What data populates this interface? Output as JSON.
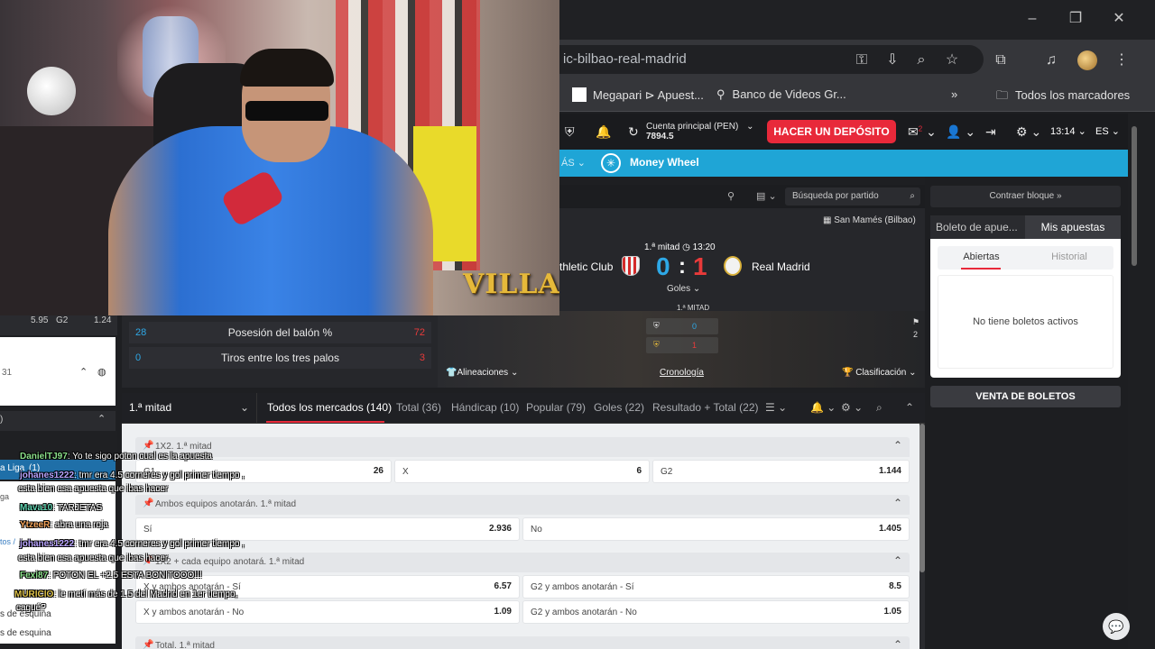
{
  "browser": {
    "url": "ic-bilbao-real-madrid",
    "window_controls": [
      "–",
      "❐",
      "✕"
    ],
    "bookmarks": [
      {
        "label": "Megapari ⊳ Apuest..."
      },
      {
        "label": "Banco de Videos Gr..."
      }
    ],
    "bookmarks_more": "»",
    "all_bookmarks": "Todos los marcadores"
  },
  "site": {
    "account_label": "Cuenta principal",
    "account_currency": "(PEN)",
    "account_balance": "7894.5",
    "deposit_button": "HACER UN DEPÓSITO",
    "messages_badge": "2",
    "time": "13:14",
    "language": "ES",
    "games_bar": {
      "more": "ÁS",
      "game": "Money Wheel"
    },
    "match_search_placeholder": "Búsqueda por partido"
  },
  "match": {
    "venue": "San Mamés (Bilbao)",
    "period": "1.ª mitad",
    "clock": "13:20",
    "home_team": "thletic Club",
    "away_team": "Real Madrid",
    "home_score": "0",
    "score_separator": ":",
    "away_score": "1",
    "goals_toggle": "Goles",
    "period_table_label": "1.ª MITAD",
    "period_home": "0",
    "period_away": "1",
    "side_number": "2",
    "links": {
      "lineups": "Alineaciones",
      "timeline": "Cronología",
      "standings": "Clasificación"
    }
  },
  "stats": [
    {
      "left": "28",
      "name": "Posesión del balón %",
      "right": "72"
    },
    {
      "left": "0",
      "name": "Tiros entre los tres palos",
      "right": "3"
    }
  ],
  "market_tabs": {
    "half": "1.ª mitad",
    "tabs": [
      "Todos los mercados (140)",
      "Total (36)",
      "Hándicap (10)",
      "Popular (79)",
      "Goles (22)",
      "Resultado + Total (22)"
    ]
  },
  "markets": [
    {
      "title": "1X2. 1.ª mitad",
      "odds": [
        {
          "name": "G1",
          "value": "26"
        },
        {
          "name": "X",
          "value": "6"
        },
        {
          "name": "G2",
          "value": "1.144"
        }
      ]
    },
    {
      "title": "Ambos equipos anotarán. 1.ª mitad",
      "odds": [
        {
          "name": "Sí",
          "value": "2.936"
        },
        {
          "name": "No",
          "value": "1.405"
        }
      ]
    },
    {
      "title": "1X2 + cada equipo anotará. 1.ª mitad",
      "odds": [
        {
          "name": "X y ambos anotarán - Sí",
          "value": "6.57"
        },
        {
          "name": "G2 y ambos anotarán - Sí",
          "value": "8.5"
        },
        {
          "name": "X y ambos anotarán - No",
          "value": "1.09"
        },
        {
          "name": "G2 y ambos anotarán - No",
          "value": "1.05"
        }
      ]
    },
    {
      "title": "Total. 1.ª mitad",
      "odds": []
    }
  ],
  "bet_slip": {
    "collapse": "Contraer bloque »",
    "tab_slip": "Boleto de apue...",
    "tab_my_bets": "Mis apuestas",
    "open": "Abiertas",
    "history": "Historial",
    "empty": "No tiene boletos activos",
    "sale": "VENTA DE BOLETOS"
  },
  "stream": {
    "logo": "VILLA"
  },
  "left_pane": {
    "odds": [
      "5.95",
      "G2",
      "1.24"
    ],
    "id_fragment": "31",
    "league": "a Liga",
    "league_count": "(1)",
    "row_a": "ga",
    "row_b": "tos /",
    "row_c": "s de esquina",
    "row_d": "s de esquina"
  },
  "chat": [
    {
      "user": "DanielTJ97",
      "text": ": Yo te sigo poton cual es la apuesta"
    },
    {
      "user": "johanes1222",
      "text": ": tmr era 4.5 corneres y gol primer tiempo ,"
    },
    {
      "user": "",
      "text": "esta bien esa apuesta que ibas hacer"
    },
    {
      "user": "Mava10",
      "text": ": TARJETAS"
    },
    {
      "user": "YtzeeR",
      "text": ": abra una roja"
    },
    {
      "user": "johanes1222",
      "text": ": tmr era 4.5 corneres y gol primer tiempo ,"
    },
    {
      "user": "",
      "text": "esta bien esa apuesta que ibas hacer"
    },
    {
      "user": "Fexi87",
      "text": ": POTON EL +2.5 ESTA BONITOOO!!!"
    },
    {
      "user": "MURICIO",
      "text": ": le metí más de 1.5 del Madrid en 1er tiempo,"
    },
    {
      "user": "",
      "text": "cagué?"
    }
  ],
  "colors": {
    "accent_red": "#e8293a",
    "home_blue": "#2ea8e6",
    "games_bar": "#1fa5d6"
  }
}
